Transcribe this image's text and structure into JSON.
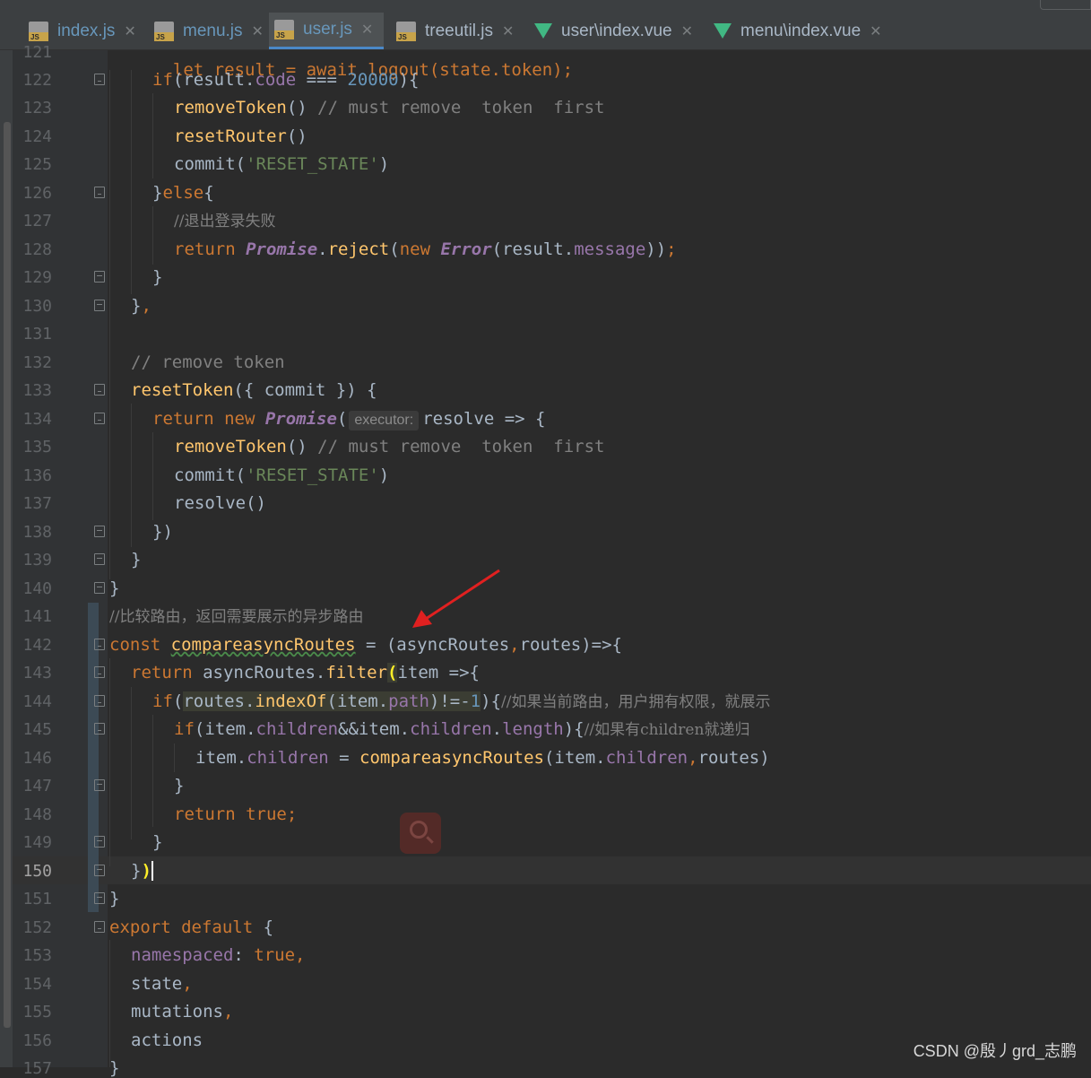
{
  "tabs": [
    {
      "label": "index.js",
      "type": "js",
      "active": false
    },
    {
      "label": "menu.js",
      "type": "js",
      "active": false
    },
    {
      "label": "user.js",
      "type": "js",
      "active": true
    },
    {
      "label": "treeutil.js",
      "type": "js",
      "active": false
    },
    {
      "label": "user\\index.vue",
      "type": "vue",
      "active": false
    },
    {
      "label": "menu\\index.vue",
      "type": "vue",
      "active": false
    }
  ],
  "editor": {
    "current_line": "150",
    "inlay_hint": "executor:",
    "line_numbers": [
      "121",
      "122",
      "123",
      "124",
      "125",
      "126",
      "127",
      "128",
      "129",
      "130",
      "131",
      "132",
      "133",
      "134",
      "135",
      "136",
      "137",
      "138",
      "139",
      "140",
      "141",
      "142",
      "143",
      "144",
      "145",
      "146",
      "147",
      "148",
      "149",
      "150",
      "151",
      "152",
      "153",
      "154",
      "155",
      "156",
      "157"
    ],
    "lines": {
      "l121": "let result = await logout(state.token);",
      "l122_kw": "if",
      "l122_a": "(result.",
      "l122_prop": "code",
      "l122_b": " === ",
      "l122_num": "20000",
      "l122_c": "){",
      "l123_fn": "removeToken",
      "l123_a": "() ",
      "l123_cmt": "// must remove  token  first",
      "l124_fn": "resetRouter",
      "l124_a": "()",
      "l125_a": "commit(",
      "l125_str": "'RESET_STATE'",
      "l125_b": ")",
      "l126_a": "}",
      "l126_kw": "else",
      "l126_b": "{",
      "l127_cmt": "//退出登录失败",
      "l128_kw": "return ",
      "l128_cls": "Promise",
      "l128_a": ".",
      "l128_fn": "reject",
      "l128_b": "(",
      "l128_kw2": "new ",
      "l128_cls2": "Error",
      "l128_c": "(result.",
      "l128_prop": "message",
      "l128_d": "))",
      "l128_semi": ";",
      "l129": "}",
      "l130_a": "}",
      "l130_comma": ",",
      "l132_cmt": "// remove token",
      "l133_fn": "resetToken",
      "l133_a": "({ commit }) {",
      "l134_kw": "return ",
      "l134_kw2": "new ",
      "l134_cls": "Promise",
      "l134_a": "(",
      "l134_b": "resolve => {",
      "l135_fn": "removeToken",
      "l135_a": "() ",
      "l135_cmt": "// must remove  token  first",
      "l136_a": "commit(",
      "l136_str": "'RESET_STATE'",
      "l136_b": ")",
      "l137": "resolve()",
      "l138": "})",
      "l139": "}",
      "l140": "}",
      "l141_cmt": "//比较路由，返回需要展示的异步路由",
      "l142_kw": "const ",
      "l142_fn": "compareasyncRoutes",
      "l142_a": " = (asyncRoutes",
      "l142_comma": ",",
      "l142_b": "routes)=>{",
      "l143_kw": "return ",
      "l143_a": "asyncRoutes.",
      "l143_fn": "filter",
      "l143_paren": "(",
      "l143_b": "item =>{",
      "l144_kw": "if",
      "l144_a": "(",
      "l144_b": "routes.",
      "l144_fn": "indexOf",
      "l144_c": "(item.",
      "l144_prop": "path",
      "l144_d": ")!=-",
      "l144_num": "1",
      "l144_e": "){",
      "l144_cmt": "//如果当前路由，用户拥有权限，就展示",
      "l145_kw": "if",
      "l145_a": "(item.",
      "l145_prop": "children",
      "l145_b": "&&item.",
      "l145_prop2": "children",
      "l145_c": ".",
      "l145_prop3": "length",
      "l145_d": "){",
      "l145_cmt": "//如果有children就递归",
      "l146_a": "item.",
      "l146_prop": "children",
      "l146_b": " = ",
      "l146_fn": "compareasyncRoutes",
      "l146_c": "(item.",
      "l146_prop2": "children",
      "l146_comma": ",",
      "l146_d": "routes)",
      "l147": "}",
      "l148_kw": "return ",
      "l148_kw2": "true",
      "l148_semi": ";",
      "l149": "}",
      "l150_a": "}",
      "l150_paren": ")",
      "l151": "}",
      "l152_kw": "export default ",
      "l152_a": "{",
      "l153_prop": "namespaced",
      "l153_a": ": ",
      "l153_kw": "true",
      "l153_comma": ",",
      "l154_a": "state",
      "l154_comma": ",",
      "l155_a": "mutations",
      "l155_comma": ",",
      "l156_a": "actions",
      "l157": "}"
    }
  },
  "watermark": "CSDN @殷丿grd_志鹏",
  "colors": {
    "background": "#2b2b2b",
    "keyword": "#cc7832",
    "function": "#ffc66d",
    "string": "#6a8759",
    "number": "#6897bb",
    "property": "#9876aa",
    "comment": "#808080",
    "annotation_arrow": "#e02020"
  }
}
